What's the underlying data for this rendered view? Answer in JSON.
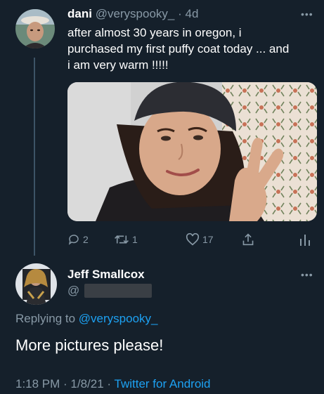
{
  "tweet": {
    "display_name": "dani",
    "handle": "@veryspooky_",
    "separator": "·",
    "time": "4d",
    "text_lines": [
      "after almost 30 years in oregon, i",
      "purchased my first puffy coat today ... and",
      "i am very warm !!!!!"
    ],
    "actions": {
      "replies": "2",
      "retweets": "1",
      "likes": "17"
    }
  },
  "reply": {
    "display_name": "Jeff Smallcox",
    "handle_prefix": "@",
    "replying_label": "Replying to",
    "replying_handle": "@veryspooky_",
    "text": "More pictures please!",
    "timestamp": "1:18 PM · 1/8/21 ·",
    "client": "Twitter for Android"
  },
  "colors": {
    "background": "#15202b",
    "muted": "#8899a6",
    "accent": "#1da1f2"
  },
  "icons": [
    "reply-icon",
    "retweet-icon",
    "like-icon",
    "share-icon",
    "analytics-icon",
    "more-icon"
  ]
}
